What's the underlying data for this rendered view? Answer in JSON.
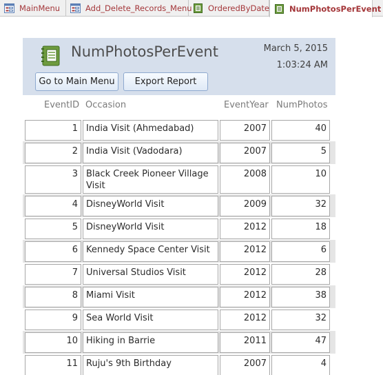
{
  "tabs": [
    {
      "label": "MainMenu",
      "icon": "form-icon"
    },
    {
      "label": "Add_Delete_Records_Menu",
      "icon": "form-icon"
    },
    {
      "label": "OrderedByDate",
      "icon": "report-icon"
    },
    {
      "label": "NumPhotosPerEvent",
      "icon": "report-icon",
      "active": true
    }
  ],
  "report": {
    "title": "NumPhotosPerEvent",
    "date": "March 5, 2015",
    "time": "1:03:24 AM",
    "buttons": {
      "main_menu": "Go to Main Menu",
      "export": "Export Report"
    }
  },
  "columns": [
    "EventID",
    "Occasion",
    "EventYear",
    "NumPhotos"
  ],
  "rows": [
    {
      "id": "1",
      "occasion": "India Visit (Ahmedabad)",
      "year": "2007",
      "photos": "40"
    },
    {
      "id": "2",
      "occasion": "India Visit (Vadodara)",
      "year": "2007",
      "photos": "5"
    },
    {
      "id": "3",
      "occasion": "Black Creek Pioneer Village Visit",
      "year": "2008",
      "photos": "10"
    },
    {
      "id": "4",
      "occasion": "DisneyWorld Visit",
      "year": "2009",
      "photos": "32"
    },
    {
      "id": "5",
      "occasion": "DisneyWorld Visit",
      "year": "2012",
      "photos": "18"
    },
    {
      "id": "6",
      "occasion": "Kennedy Space Center Visit",
      "year": "2012",
      "photos": "6"
    },
    {
      "id": "7",
      "occasion": "Universal Studios Visit",
      "year": "2012",
      "photos": "28"
    },
    {
      "id": "8",
      "occasion": "Miami Visit",
      "year": "2012",
      "photos": "38"
    },
    {
      "id": "9",
      "occasion": "Sea World Visit",
      "year": "2012",
      "photos": "32"
    },
    {
      "id": "10",
      "occasion": "Hiking in Barrie",
      "year": "2011",
      "photos": "47"
    },
    {
      "id": "11",
      "occasion": "Ruju's 9th Birthday",
      "year": "2007",
      "photos": "4"
    }
  ]
}
